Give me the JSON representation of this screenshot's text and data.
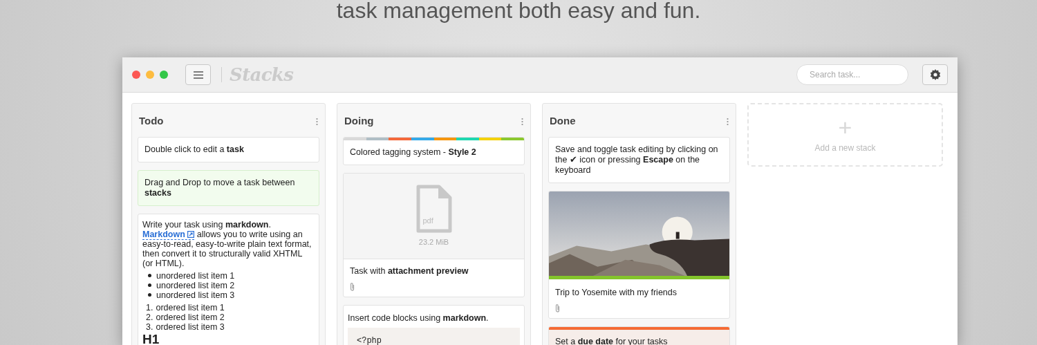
{
  "headline": "task management both easy and fun.",
  "app": {
    "title": "Stacks",
    "search": {
      "placeholder": "Search task..."
    }
  },
  "stacks": [
    {
      "title": "Todo",
      "cards": [
        {
          "kind": "text",
          "highlighted": false,
          "text": "Double click to edit a **task**"
        },
        {
          "kind": "text",
          "highlighted": true,
          "text": "Drag and Drop to move a task between **stacks**"
        },
        {
          "kind": "markdown",
          "highlighted": false,
          "before": "Write your task using **markdown**.",
          "link": "Markdown",
          "after": "allows you to write using an easy-to-read, easy-to-write plain text format, then convert it to structurally valid XHTML (or HTML).",
          "bullets": [
            "unordered list item 1",
            "unordered list item 2",
            "unordered list item 3"
          ],
          "ordered": [
            {
              "number": "1.",
              "text": "ordered list item 1"
            },
            {
              "number": "2.",
              "text": "ordered list item 2"
            },
            {
              "number": "3.",
              "text": "ordered list item 3"
            }
          ],
          "heading": "H1"
        }
      ]
    },
    {
      "title": "Doing",
      "cards": [
        {
          "kind": "text",
          "highlighted": false,
          "text": "Colored tagging system - **Style 2**",
          "tags": [
            {
              "color": "#d9d9d9"
            },
            {
              "color": "#b0bec5"
            },
            {
              "color": "#f4683a"
            },
            {
              "color": "#35a9e8"
            },
            {
              "color": "#f5960f"
            },
            {
              "color": "#1fd8b0"
            },
            {
              "color": "#f4d20d"
            },
            {
              "color": "#8bc82f"
            }
          ]
        },
        {
          "kind": "attachment",
          "highlighted": false,
          "ext": "pdf",
          "size": "23.2 MiB",
          "text": "Task with **attachment preview**"
        },
        {
          "kind": "code",
          "highlighted": false,
          "text": "Insert code blocks using **markdown**.",
          "code": [
            "<?php"
          ]
        }
      ]
    },
    {
      "title": "Done",
      "cards": [
        {
          "kind": "text",
          "highlighted": false,
          "text": "Save and toggle task editing by clicking on the ✔ icon or pressing **Escape** on the keyboard"
        },
        {
          "highlighted": false,
          "text": "Trip to Yosemite with my friends",
          "color": "#84c52c"
        },
        {
          "kind": "text",
          "highlighted": false,
          "text": "Set a **due date** for your tasks",
          "color": "#f56b35"
        }
      ]
    }
  ],
  "add_stack": {
    "icon": "+",
    "label": "Add a new stack"
  }
}
